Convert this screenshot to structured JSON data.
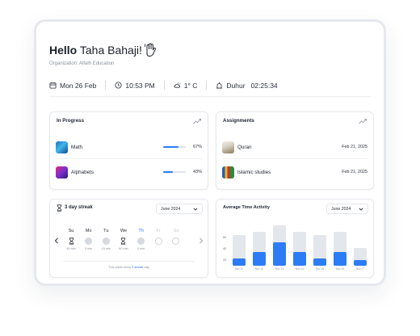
{
  "greeting": {
    "hello": "Hello",
    "name": "Taha Bahaji!",
    "organization": "Organization: Alfalh Education"
  },
  "infobar": {
    "date": "Mon 26 Feb",
    "time": "10:53 PM",
    "weather": "1° C",
    "prayer_name": "Duhur",
    "prayer_time": "02:25:34"
  },
  "in_progress": {
    "title": "In Progress",
    "items": [
      {
        "label": "Math",
        "percent_text": "67%",
        "progress": 0.67
      },
      {
        "label": "Alphabets",
        "percent_text": "43%",
        "progress": 0.43
      }
    ]
  },
  "assignments": {
    "title": "Assignments",
    "items": [
      {
        "label": "Quran",
        "date": "Feb 21, 2025"
      },
      {
        "label": "Islamic studies",
        "date": "Feb 21, 2025"
      }
    ]
  },
  "streak": {
    "title": "3 day streak",
    "month": "June 2024",
    "days": [
      {
        "name": "Su",
        "minutes": "45 min",
        "state": "done"
      },
      {
        "name": "Mo",
        "minutes": "0 min",
        "state": "missed"
      },
      {
        "name": "Tu",
        "minutes": "15 min",
        "state": "missed"
      },
      {
        "name": "We",
        "minutes": "60 min",
        "state": "done"
      },
      {
        "name": "Th",
        "minutes": "0 min",
        "state": "today"
      },
      {
        "name": "Fr",
        "minutes": "",
        "state": "future"
      },
      {
        "name": "Sa",
        "minutes": "",
        "state": "future"
      }
    ],
    "footer_text": "This week keep ",
    "footer_link": "3 streak",
    "footer_end": " day"
  },
  "chart": {
    "title": "Average Time Activity",
    "month": "June 2024"
  },
  "colors": {
    "accent": "#2c7cf6",
    "track": "#e3e6eb"
  },
  "chart_data": {
    "type": "bar",
    "title": "Average Time Activity",
    "categories": [
      "Nov 11",
      "Nov 12",
      "Nov 13",
      "Nov 14",
      "Nov 15",
      "Nov 16",
      "Nov 17"
    ],
    "series": [
      {
        "values": [
          65,
          70,
          82,
          70,
          65,
          70,
          42
        ]
      },
      {
        "values": [
          23,
          34,
          52,
          34,
          23,
          34,
          20
        ]
      }
    ],
    "yticks": [
      "60",
      "40",
      "20"
    ],
    "ylim": [
      10,
      90
    ]
  }
}
